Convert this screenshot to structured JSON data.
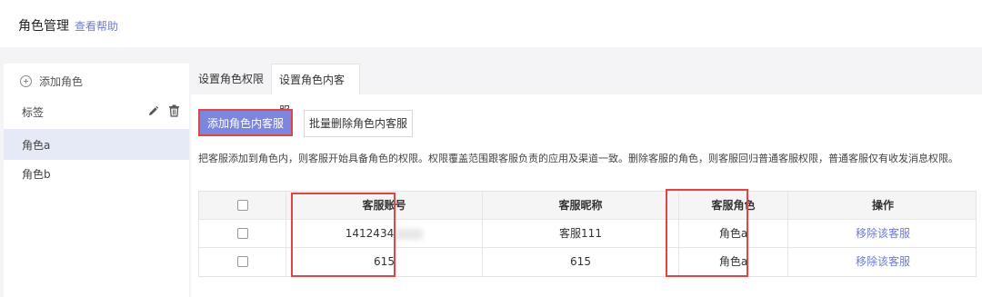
{
  "header": {
    "title": "角色管理",
    "help": "查看帮助"
  },
  "sidebar": {
    "add_label": "添加角色",
    "items": [
      {
        "label": "标签"
      },
      {
        "label": "角色a"
      },
      {
        "label": "角色b"
      }
    ]
  },
  "tabs": [
    {
      "label": "设置角色权限"
    },
    {
      "label": "设置角色内客服"
    }
  ],
  "actions": {
    "add_label": "添加角色内客服",
    "bulk_delete_label": "批量删除角色内客服"
  },
  "description": "把客服添加到角色内，则客服开始具备角色的权限。权限覆盖范围跟客服负责的应用及渠道一致。删除客服的角色，则客服回归普通客服权限，普通客服仅有收发消息权限。",
  "table": {
    "headers": [
      "客服账号",
      "客服昵称",
      "客服角色",
      "操作"
    ],
    "rows": [
      {
        "account": "1412434",
        "nickname": "客服111",
        "role": "角色a",
        "action": "移除该客服"
      },
      {
        "account": "615",
        "nickname": "615",
        "role": "角色a",
        "action": "移除该客服"
      }
    ]
  },
  "colors": {
    "accent": "#7b86dc",
    "link": "#6f7ad3",
    "highlight": "#e04545"
  }
}
